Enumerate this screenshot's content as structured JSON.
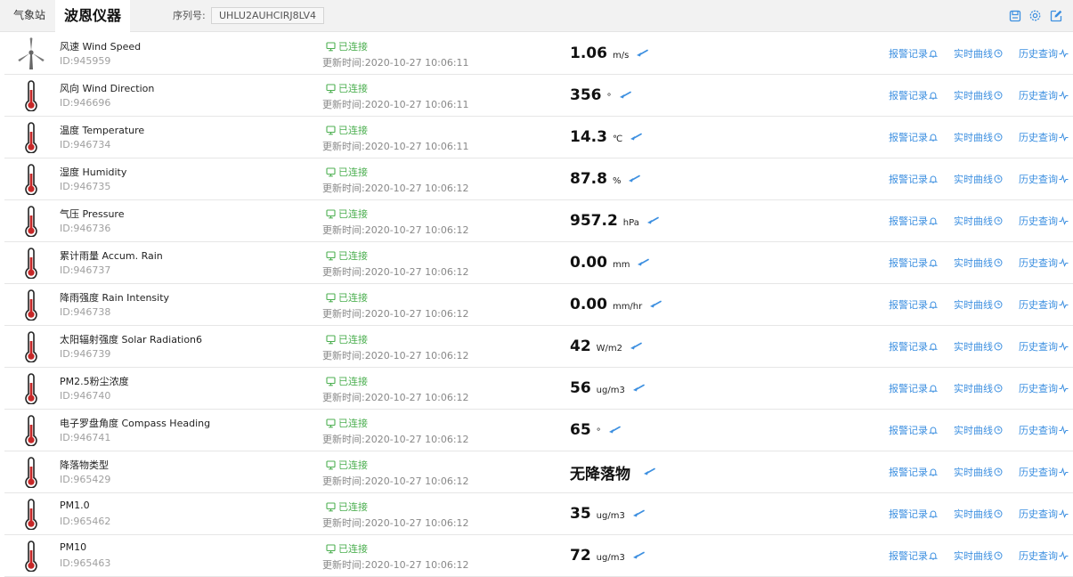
{
  "header": {
    "tab_label": "气象站",
    "device_name": "波恩仪器",
    "serial_label": "序列号:",
    "serial_value": "UHLU2AUHCIRJ8LV4",
    "icons": [
      "save-icon",
      "settings-icon",
      "edit-icon"
    ]
  },
  "colors": {
    "accent": "#3c8fe0",
    "connected": "#4caf50",
    "thermometer": "#c62828"
  },
  "actions": {
    "alarm_label": "报警记录",
    "realtime_label": "实时曲线",
    "history_label": "历史查询"
  },
  "sensors": [
    {
      "name": "风速 Wind Speed",
      "id": "ID:945959",
      "status": "已连接",
      "updated": "更新时间:2020-10-27 10:06:11",
      "value": "1.06",
      "unit": "m/s",
      "icon": "wind-turbine-icon"
    },
    {
      "name": "风向 Wind Direction",
      "id": "ID:946696",
      "status": "已连接",
      "updated": "更新时间:2020-10-27 10:06:11",
      "value": "356",
      "unit": "°",
      "icon": "thermometer-icon"
    },
    {
      "name": "温度 Temperature",
      "id": "ID:946734",
      "status": "已连接",
      "updated": "更新时间:2020-10-27 10:06:11",
      "value": "14.3",
      "unit": "℃",
      "icon": "thermometer-icon"
    },
    {
      "name": "湿度 Humidity",
      "id": "ID:946735",
      "status": "已连接",
      "updated": "更新时间:2020-10-27 10:06:12",
      "value": "87.8",
      "unit": "%",
      "icon": "thermometer-icon"
    },
    {
      "name": "气压 Pressure",
      "id": "ID:946736",
      "status": "已连接",
      "updated": "更新时间:2020-10-27 10:06:12",
      "value": "957.2",
      "unit": "hPa",
      "icon": "thermometer-icon"
    },
    {
      "name": "累计雨量 Accum. Rain",
      "id": "ID:946737",
      "status": "已连接",
      "updated": "更新时间:2020-10-27 10:06:12",
      "value": "0.00",
      "unit": "mm",
      "icon": "thermometer-icon"
    },
    {
      "name": "降雨强度 Rain Intensity",
      "id": "ID:946738",
      "status": "已连接",
      "updated": "更新时间:2020-10-27 10:06:12",
      "value": "0.00",
      "unit": "mm/hr",
      "icon": "thermometer-icon"
    },
    {
      "name": "太阳辐射强度 Solar Radiation6",
      "id": "ID:946739",
      "status": "已连接",
      "updated": "更新时间:2020-10-27 10:06:12",
      "value": "42",
      "unit": "W/m2",
      "icon": "thermometer-icon"
    },
    {
      "name": "PM2.5粉尘浓度",
      "id": "ID:946740",
      "status": "已连接",
      "updated": "更新时间:2020-10-27 10:06:12",
      "value": "56",
      "unit": "ug/m3",
      "icon": "thermometer-icon"
    },
    {
      "name": "电子罗盘角度 Compass Heading",
      "id": "ID:946741",
      "status": "已连接",
      "updated": "更新时间:2020-10-27 10:06:12",
      "value": "65",
      "unit": "°",
      "icon": "thermometer-icon"
    },
    {
      "name": "降落物类型",
      "id": "ID:965429",
      "status": "已连接",
      "updated": "更新时间:2020-10-27 10:06:12",
      "value": "无降落物",
      "unit": "",
      "icon": "thermometer-icon"
    },
    {
      "name": "PM1.0",
      "id": "ID:965462",
      "status": "已连接",
      "updated": "更新时间:2020-10-27 10:06:12",
      "value": "35",
      "unit": "ug/m3",
      "icon": "thermometer-icon"
    },
    {
      "name": "PM10",
      "id": "ID:965463",
      "status": "已连接",
      "updated": "更新时间:2020-10-27 10:06:12",
      "value": "72",
      "unit": "ug/m3",
      "icon": "thermometer-icon"
    }
  ]
}
